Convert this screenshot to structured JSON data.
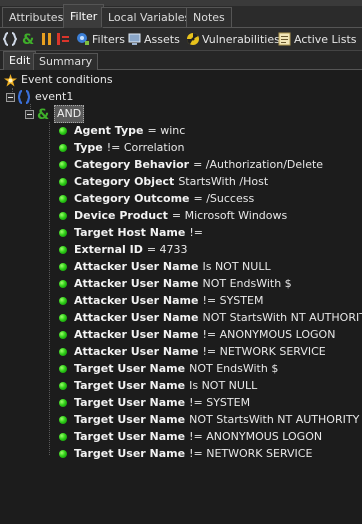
{
  "top_tabs": [
    "Attributes",
    "Filter",
    "Local Variables",
    "Notes"
  ],
  "active_top_tab": "Filter",
  "toolbar": {
    "filters": "Filters",
    "assets": "Assets",
    "vulnerabilities": "Vulnerabilities",
    "active_lists": "Active Lists"
  },
  "inner_tabs": [
    "Edit",
    "Summary"
  ],
  "active_inner_tab": "Edit",
  "tree": {
    "root": "Event conditions",
    "event": "event1",
    "operator": "AND",
    "conditions": [
      {
        "field": "Agent Type",
        "rest": "= winc"
      },
      {
        "field": "Type",
        "rest": "!= Correlation"
      },
      {
        "field": "Category Behavior",
        "rest": "= /Authorization/Delete"
      },
      {
        "field": "Category Object",
        "rest": "StartsWith /Host"
      },
      {
        "field": "Category Outcome",
        "rest": "= /Success"
      },
      {
        "field": "Device Product",
        "rest": "= Microsoft Windows"
      },
      {
        "field": "Target Host Name",
        "rest": "!="
      },
      {
        "field": "External ID",
        "rest": "= 4733"
      },
      {
        "field": "Attacker User Name",
        "rest": "Is NOT NULL"
      },
      {
        "field": "Attacker User Name",
        "rest": "NOT EndsWith $"
      },
      {
        "field": "Attacker User Name",
        "rest": "!= SYSTEM"
      },
      {
        "field": "Attacker User Name",
        "rest": "NOT StartsWith NT AUTHORITY"
      },
      {
        "field": "Attacker User Name",
        "rest": "!= ANONYMOUS LOGON"
      },
      {
        "field": "Attacker User Name",
        "rest": "!= NETWORK SERVICE"
      },
      {
        "field": "Target User Name",
        "rest": "NOT EndsWith $"
      },
      {
        "field": "Target User Name",
        "rest": "Is NOT NULL"
      },
      {
        "field": "Target User Name",
        "rest": "!= SYSTEM"
      },
      {
        "field": "Target User Name",
        "rest": "NOT StartsWith NT AUTHORITY"
      },
      {
        "field": "Target User Name",
        "rest": "!= ANONYMOUS LOGON"
      },
      {
        "field": "Target User Name",
        "rest": "!= NETWORK SERVICE"
      }
    ]
  },
  "colors": {
    "background": "#1c1c1c",
    "bullet": "#2fcf18",
    "brace_icon": "#3a6fd8",
    "ampersand_icon": "#3fae2a"
  },
  "icons": [
    "brace-icon",
    "ampersand-icon",
    "pause-icon",
    "not-equal-icon",
    "filters-icon",
    "assets-icon",
    "vulnerabilities-icon",
    "active-lists-icon",
    "event-conditions-icon"
  ]
}
